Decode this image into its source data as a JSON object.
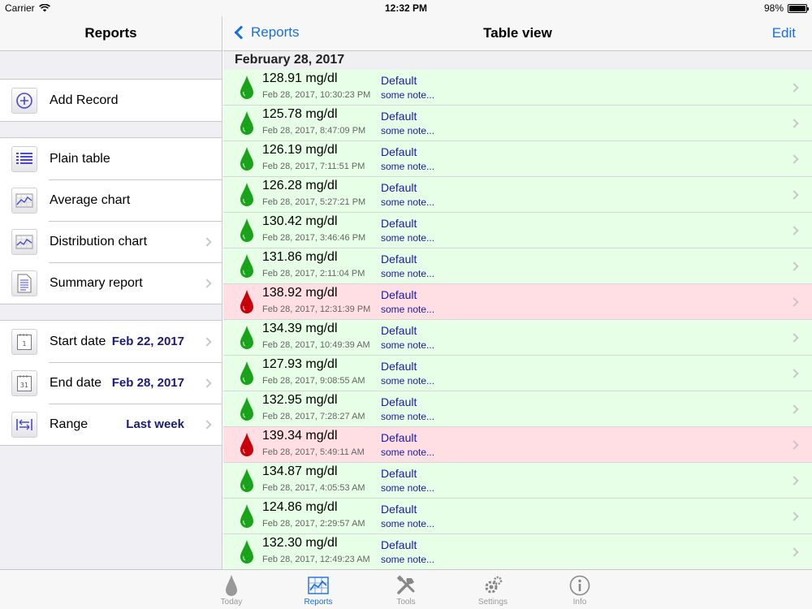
{
  "status": {
    "carrier": "Carrier",
    "time": "12:32 PM",
    "battery": "98%",
    "battery_level": 0.98
  },
  "left": {
    "title": "Reports",
    "add_record": "Add Record",
    "reports": [
      {
        "label": "Plain table",
        "icon": "list-icon"
      },
      {
        "label": "Average chart",
        "icon": "chart-icon"
      },
      {
        "label": "Distribution chart",
        "icon": "chart-icon"
      },
      {
        "label": "Summary report",
        "icon": "document-icon"
      }
    ],
    "filters": [
      {
        "label": "Start date",
        "value": "Feb 22, 2017",
        "icon": "calendar-icon",
        "icon_text": "1"
      },
      {
        "label": "End date",
        "value": "Feb 28, 2017",
        "icon": "calendar-icon",
        "icon_text": "31"
      },
      {
        "label": "Range",
        "value": "Last week",
        "icon": "range-icon"
      }
    ]
  },
  "right": {
    "back_label": "Reports",
    "title": "Table view",
    "edit_label": "Edit",
    "section": "February 28, 2017",
    "records": [
      {
        "value": "128.91 mg/dl",
        "time": "Feb 28, 2017, 10:30:23 PM",
        "category": "Default",
        "note": "some note...",
        "status": "normal"
      },
      {
        "value": "125.78 mg/dl",
        "time": "Feb 28, 2017, 8:47:09 PM",
        "category": "Default",
        "note": "some note...",
        "status": "normal"
      },
      {
        "value": "126.19 mg/dl",
        "time": "Feb 28, 2017, 7:11:51 PM",
        "category": "Default",
        "note": "some note...",
        "status": "normal"
      },
      {
        "value": "126.28 mg/dl",
        "time": "Feb 28, 2017, 5:27:21 PM",
        "category": "Default",
        "note": "some note...",
        "status": "normal"
      },
      {
        "value": "130.42 mg/dl",
        "time": "Feb 28, 2017, 3:46:46 PM",
        "category": "Default",
        "note": "some note...",
        "status": "normal"
      },
      {
        "value": "131.86 mg/dl",
        "time": "Feb 28, 2017, 2:11:04 PM",
        "category": "Default",
        "note": "some note...",
        "status": "normal"
      },
      {
        "value": "138.92 mg/dl",
        "time": "Feb 28, 2017, 12:31:39 PM",
        "category": "Default",
        "note": "some note...",
        "status": "high"
      },
      {
        "value": "134.39 mg/dl",
        "time": "Feb 28, 2017, 10:49:39 AM",
        "category": "Default",
        "note": "some note...",
        "status": "normal"
      },
      {
        "value": "127.93 mg/dl",
        "time": "Feb 28, 2017, 9:08:55 AM",
        "category": "Default",
        "note": "some note...",
        "status": "normal"
      },
      {
        "value": "132.95 mg/dl",
        "time": "Feb 28, 2017, 7:28:27 AM",
        "category": "Default",
        "note": "some note...",
        "status": "normal"
      },
      {
        "value": "139.34 mg/dl",
        "time": "Feb 28, 2017, 5:49:11 AM",
        "category": "Default",
        "note": "some note...",
        "status": "high"
      },
      {
        "value": "134.87 mg/dl",
        "time": "Feb 28, 2017, 4:05:53 AM",
        "category": "Default",
        "note": "some note...",
        "status": "normal"
      },
      {
        "value": "124.86 mg/dl",
        "time": "Feb 28, 2017, 2:29:57 AM",
        "category": "Default",
        "note": "some note...",
        "status": "normal"
      },
      {
        "value": "132.30 mg/dl",
        "time": "Feb 28, 2017, 12:49:23 AM",
        "category": "Default",
        "note": "some note...",
        "status": "normal"
      }
    ]
  },
  "tabs": [
    {
      "label": "Today",
      "icon": "drop-icon",
      "active": false
    },
    {
      "label": "Reports",
      "icon": "chart-icon",
      "active": true
    },
    {
      "label": "Tools",
      "icon": "tools-icon",
      "active": false
    },
    {
      "label": "Settings",
      "icon": "gear-icon",
      "active": false
    },
    {
      "label": "Info",
      "icon": "info-icon",
      "active": false
    }
  ],
  "colors": {
    "accent": "#1a6fe0",
    "normal_row": "#e6ffe6",
    "high_row": "#ffdfe3",
    "normal_drop": "#1aa31a",
    "high_drop": "#c8000a"
  }
}
